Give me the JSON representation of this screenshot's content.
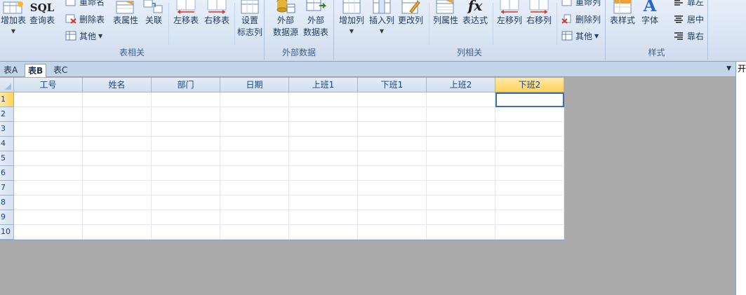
{
  "ribbon": {
    "groups": {
      "table": {
        "label": "表相关",
        "add_table": "增加表",
        "query_table": "查询表",
        "query_table_icon_text": "SQL",
        "rename": "重命名",
        "delete_table": "删除表",
        "other": "其他",
        "table_props": "表属性",
        "relation": "关联",
        "move_left": "左移表",
        "move_right": "右移表",
        "set_flag_1": "设置",
        "set_flag_2": "标志列"
      },
      "external": {
        "label": "外部数据",
        "ext_source_1": "外部",
        "ext_source_2": "数据源",
        "ext_table_1": "外部",
        "ext_table_2": "数据表"
      },
      "column": {
        "label": "列相关",
        "add_col": "增加列",
        "insert_col": "插入列",
        "change_col": "更改列",
        "col_props": "列属性",
        "expression": "表达式",
        "expression_icon_text": "fx",
        "move_left": "左移列",
        "move_right": "右移列",
        "rename_col": "重命列",
        "delete_col": "删除列",
        "other": "其他"
      },
      "style": {
        "label": "样式",
        "table_style": "表样式",
        "font": "字体",
        "align_left": "靠左",
        "align_center": "居中",
        "align_right": "靠右"
      }
    }
  },
  "sheet_tabs": [
    "表A",
    "表B",
    "表C"
  ],
  "active_tab": "表B",
  "right_pane_label": "开",
  "grid": {
    "columns": [
      "工号",
      "姓名",
      "部门",
      "日期",
      "上班1",
      "下班1",
      "上班2",
      "下班2"
    ],
    "selected_column": "下班2",
    "rows": [
      "1",
      "2",
      "3",
      "4",
      "5",
      "6",
      "7",
      "8",
      "9",
      "10"
    ],
    "selected_row": "1"
  }
}
